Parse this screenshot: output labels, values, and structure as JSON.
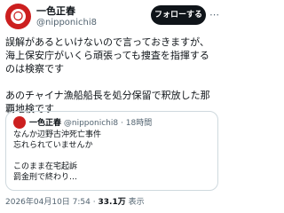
{
  "post": {
    "author_name": "一色正春",
    "author_handle": "@nipponichi8",
    "follow_label": "フォローする",
    "more_glyph": "⋯",
    "text": "誤解があるといけないので言っておきますが、海上保安庁がいくら頑張っても捜査を指揮するのは検察です\n\nあのチャイナ漁船船長を処分保留で釈放した那覇地検です"
  },
  "quoted": {
    "author_name": "一色正春",
    "author_handle": "@nipponichi8",
    "time": "18時間",
    "text": "なんか辺野古沖死亡事件\n忘れられていませんか\n\nこのまま在宅起訴\n罰金刑で終わり…"
  },
  "meta": {
    "timestamp": "2026年04月10日 7:54",
    "views_count": "33.1万",
    "views_label": "表示"
  },
  "colors": {
    "avatar": "#cc1f1f",
    "button": "#0f1419",
    "muted": "#536471",
    "border": "#cfd9de"
  }
}
